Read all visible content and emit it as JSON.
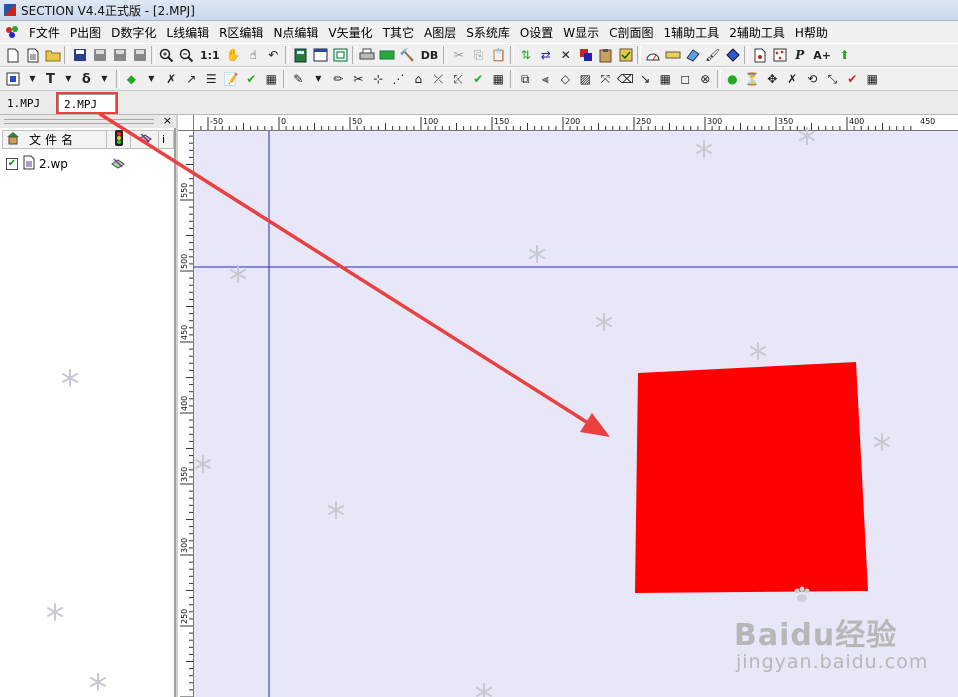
{
  "window": {
    "title": "SECTION V4.4正式版 - [2.MPJ]"
  },
  "menu": [
    "F文件",
    "P出图",
    "D数字化",
    "L线编辑",
    "R区编辑",
    "N点编辑",
    "V矢量化",
    "T其它",
    "A图层",
    "S系统库",
    "O设置",
    "W显示",
    "C剖面图",
    "1辅助工具",
    "2辅助工具",
    "H帮助"
  ],
  "toolbar1": {
    "zoom_ratio_label": "1:1",
    "db_label": "DB",
    "text_grow_label": "A+",
    "italic_p_label": "P"
  },
  "toolbar2": {
    "text_tool_label": "T",
    "delta_label": "δ"
  },
  "tabs": [
    {
      "label": "1.MPJ",
      "active": false
    },
    {
      "label": "2.MPJ",
      "active": true
    }
  ],
  "panel": {
    "close_label": "×",
    "header_name": "文件名",
    "header_extra": "i",
    "files": [
      {
        "name": "2.wp",
        "checked": true,
        "check_mark": "✔"
      }
    ]
  },
  "ruler_top": {
    "ticks": [
      "-50",
      "0",
      "50",
      "100",
      "150",
      "200",
      "250",
      "300",
      "350",
      "400",
      "450"
    ]
  },
  "ruler_left": {
    "ticks": [
      "550",
      "500",
      "450",
      "400",
      "350",
      "300",
      "250"
    ]
  },
  "canvas": {
    "background": "#e7e7f8",
    "crosshair_color": "#2a2ab8",
    "shape_fill": "#ff0000"
  },
  "annotation": {
    "color": "#e94040"
  },
  "watermark": {
    "brand": "Baidu经验",
    "sub": "jingyan.baidu.com"
  }
}
